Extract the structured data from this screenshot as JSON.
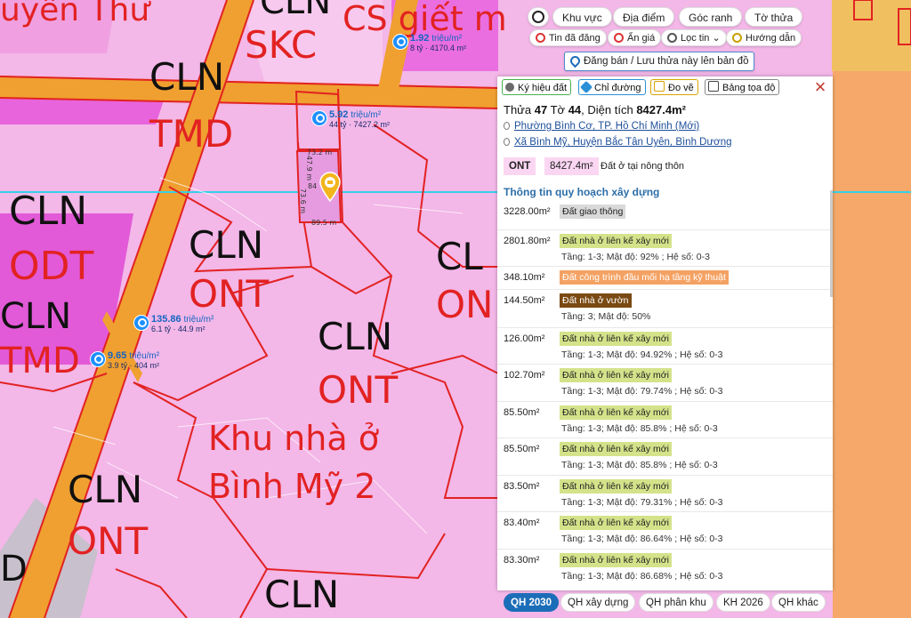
{
  "map_labels": {
    "cln_tmd_top": [
      "CLN",
      "TMD"
    ],
    "cln_skc": [
      "CLN",
      "SKC"
    ],
    "cs_giet": "CS giết m",
    "uyen_thu": "uyên Thư",
    "cln_odt": [
      "CLN",
      "ODT"
    ],
    "cln_tmd_left": [
      "CLN",
      "TMD"
    ],
    "cln_ont_mid": [
      "CLN",
      "ONT"
    ],
    "cln_ont_center": [
      "CLN",
      "ONT"
    ],
    "cln_ont_bottom": [
      "CLN",
      "ONT"
    ],
    "cln_bottom": "CLN",
    "cln_right": [
      "CL",
      "ON"
    ],
    "d_left": "D",
    "khu_nha_o": [
      "Khu nhà ở",
      "Bình Mỹ 2"
    ],
    "dim_top": "73.2 m",
    "dim_left": "47.9 m",
    "dim_right": "73.6 m",
    "dim_bottom": "89.5 m",
    "dim_label": "84"
  },
  "price_tags": [
    {
      "price": "1.92",
      "unit": "triệu/m²",
      "detail": "8 tỷ · 4170.4 m²"
    },
    {
      "price": "5.92",
      "unit": "triệu/m²",
      "detail": "44 tỷ · 7427.2 m²"
    },
    {
      "price": "135.86",
      "unit": "triệu/m²",
      "detail": "6.1 tỷ · 44.9 m²"
    },
    {
      "price": "9.65",
      "unit": "triệu/m²",
      "detail": "3.9 tỷ · 404 m²"
    }
  ],
  "top_pills": {
    "locate_icon": "crosshair-icon",
    "khu_vuc": "Khu vực",
    "dia_diem": "Địa điểm",
    "goc_ranh": "Góc ranh",
    "to_thua": "Tờ thửa",
    "tin_da_dang": "Tin đã đăng",
    "an_gia": "Ẩn giá",
    "loc_tin": "Lọc tin",
    "huong_dan": "Hướng dẫn",
    "dang_ban": "Đăng bán / Lưu thửa này lên bản đồ"
  },
  "panel": {
    "toolbar": {
      "ky_hieu_dat": "Ký hiệu đất",
      "chi_duong": "Chỉ đường",
      "do_ve": "Đo vẽ",
      "bang_toa_do": "Bảng tọa độ"
    },
    "title": {
      "thua_label": "Thửa",
      "thua": "47",
      "to_label": "Tờ",
      "to": "44",
      "dien_tich_label": ", Diện tích",
      "dien_tich": "8427.4m²"
    },
    "address_new": "Phường Bình Cơ, TP. Hồ Chí Minh (Mới)",
    "address_old": "Xã Bình Mỹ, Huyện Bắc Tân Uyên, Bình Dương",
    "land_code": "ONT",
    "land_area": "8427.4m²",
    "land_desc": "Đất ở tại nông thôn",
    "section_title": "Thông tin quy hoạch xây dựng",
    "zones": [
      {
        "area": "3228.00m²",
        "tag": "Đất giao thông",
        "color": "#d9d9d9",
        "text_color": "#222",
        "detail": ""
      },
      {
        "area": "2801.80m²",
        "tag": "Đất nhà ở liên kế xây mới",
        "color": "#d4e38a",
        "text_color": "#222",
        "detail": "Tầng: 1-3; Mật độ: 92% ; Hệ số: 0-3"
      },
      {
        "area": "348.10m²",
        "tag": "Đất công trình đầu mối hạ tầng kỹ thuật",
        "color": "#f4a263",
        "text_color": "#fff",
        "detail": ""
      },
      {
        "area": "144.50m²",
        "tag": "Đất nhà ở vườn",
        "color": "#7a4a12",
        "text_color": "#fff",
        "detail": "Tầng: 3; Mật độ: 50%"
      },
      {
        "area": "126.00m²",
        "tag": "Đất nhà ở liên kế xây mới",
        "color": "#d4e38a",
        "text_color": "#222",
        "detail": "Tầng: 1-3; Mật độ: 94.92% ; Hệ số: 0-3"
      },
      {
        "area": "102.70m²",
        "tag": "Đất nhà ở liên kế xây mới",
        "color": "#d4e38a",
        "text_color": "#222",
        "detail": "Tầng: 1-3; Mật độ: 79.74% ; Hệ số: 0-3"
      },
      {
        "area": "85.50m²",
        "tag": "Đất nhà ở liên kế xây mới",
        "color": "#d4e38a",
        "text_color": "#222",
        "detail": "Tầng: 1-3; Mật độ: 85.8% ; Hệ số: 0-3"
      },
      {
        "area": "85.50m²",
        "tag": "Đất nhà ở liên kế xây mới",
        "color": "#d4e38a",
        "text_color": "#222",
        "detail": "Tầng: 1-3; Mật độ: 85.8% ; Hệ số: 0-3"
      },
      {
        "area": "83.50m²",
        "tag": "Đất nhà ở liên kế xây mới",
        "color": "#d4e38a",
        "text_color": "#222",
        "detail": "Tầng: 1-3; Mật độ: 79.31% ; Hệ số: 0-3"
      },
      {
        "area": "83.40m²",
        "tag": "Đất nhà ở liên kế xây mới",
        "color": "#d4e38a",
        "text_color": "#222",
        "detail": "Tầng: 1-3; Mật độ: 86.64% ; Hệ số: 0-3"
      },
      {
        "area": "83.30m²",
        "tag": "Đất nhà ở liên kế xây mới",
        "color": "#d4e38a",
        "text_color": "#222",
        "detail": "Tầng: 1-3; Mật độ: 86.68% ; Hệ số: 0-3"
      }
    ]
  },
  "bottom_tabs": [
    "QH 2030",
    "QH xây dựng",
    "QH phân khu",
    "KH 2026",
    "QH khác"
  ],
  "colors": {
    "map_pink": "#f3b7e8",
    "road_orange": "#f0a030",
    "boundary_red": "#e22222",
    "magenta_zone": "#e25ad8",
    "active_tab": "#1c6db8"
  }
}
